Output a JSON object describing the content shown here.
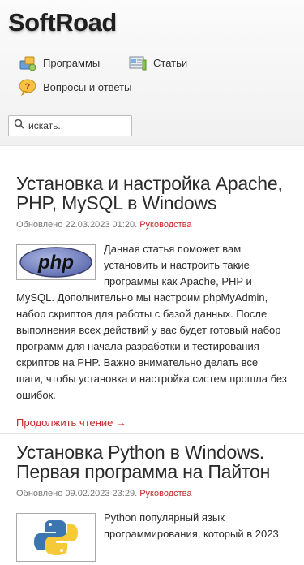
{
  "header": {
    "logo": "SoftRoad",
    "nav": [
      {
        "label": "Программы",
        "icon": "programs-icon"
      },
      {
        "label": "Статьи",
        "icon": "articles-icon"
      },
      {
        "label": "Вопросы и ответы",
        "icon": "question-icon"
      }
    ],
    "search": {
      "placeholder": "искать..",
      "value": ""
    }
  },
  "articles": [
    {
      "title": "Установка и настройка Apache, PHP, MySQL в Windows",
      "updated_label": "Обновлено",
      "date": "22.03.2023 01:20.",
      "category": "Руководства",
      "thumb": "php-logo",
      "excerpt": "Данная статья поможет вам установить и настроить такие программы как Apache, PHP и MySQL. Дополнительно мы настроим phpMyAdmin, набор скриптов для работы с базой данных. После выполнения всех действий у вас будет готовый набор программ для начала разработки и тестирования скриптов на PHP. Важно внимательно делать все шаги, чтобы установка и настройка систем прошла без ошибок.",
      "read_more": "Продолжить чтение →"
    },
    {
      "title": "Установка Python в Windows. Первая программа на Пайтон",
      "updated_label": "Обновлено",
      "date": "09.02.2023 23:29.",
      "category": "Руководства",
      "thumb": "python-logo",
      "excerpt": "Python популярный язык программирования, который в 2023"
    }
  ],
  "colors": {
    "accent": "#c62828",
    "text": "#2b2b2b",
    "meta": "#777777"
  }
}
